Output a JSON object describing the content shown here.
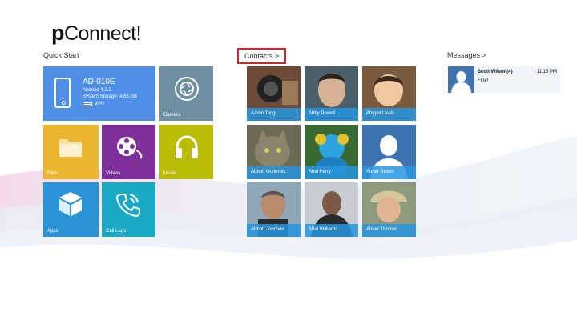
{
  "app": {
    "logo_p": "p",
    "logo_rest": "Connect!"
  },
  "sections": {
    "quick_start": "Quick Start",
    "contacts": "Contacts >",
    "messages": "Messages >"
  },
  "device": {
    "name": "AD-010E",
    "os": "Android 4.2.2",
    "storage": "System Storage: 4.63 GB",
    "battery": "99%"
  },
  "tiles": {
    "camera": "Camera",
    "files": "Files",
    "videos": "Videos",
    "music": "Music",
    "apps": "Apps",
    "call_logs": "Call Logs"
  },
  "contacts": [
    {
      "name": "Aaron Tang"
    },
    {
      "name": "Abby Powell"
    },
    {
      "name": "Abigail Lewis"
    },
    {
      "name": "Abbott Gutierrez"
    },
    {
      "name": "Abel Perry"
    },
    {
      "name": "Abner Brown"
    },
    {
      "name": "Abbott Johnson"
    },
    {
      "name": "Abel Williams"
    },
    {
      "name": "Abner Thomas"
    }
  ],
  "messages": [
    {
      "sender": "Scott Wilson(4)",
      "time": "11:15 PM",
      "body": "Fine!"
    }
  ],
  "colors": {
    "device": "#4f8fe8",
    "camera": "#6e8ea2",
    "files": "#ebb52f",
    "videos": "#7e2f9b",
    "music": "#b9bd06",
    "apps": "#2b93d7",
    "call_logs": "#1aa9c4",
    "highlight": "#d9222a"
  }
}
